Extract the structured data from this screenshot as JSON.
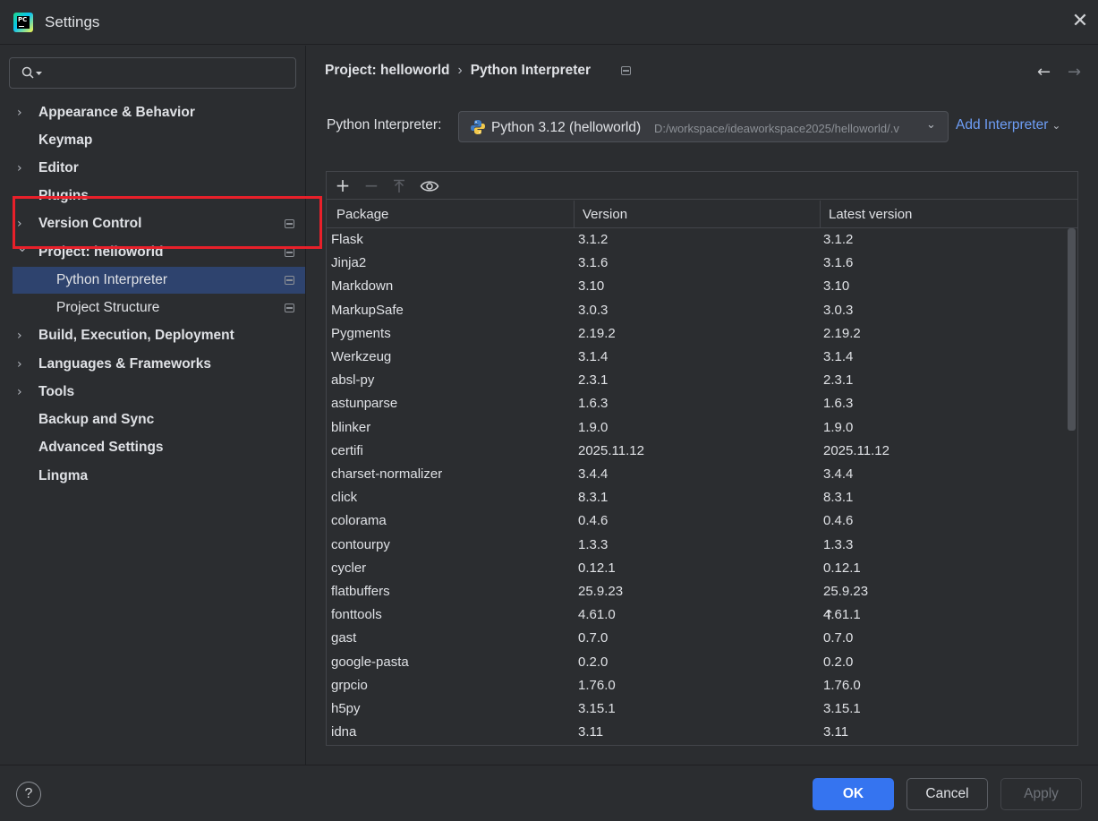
{
  "window": {
    "title": "Settings"
  },
  "search": {
    "placeholder": ""
  },
  "sidebar": {
    "items": [
      {
        "label": "Appearance & Behavior",
        "expandable": true,
        "expanded": false,
        "pinnable": false
      },
      {
        "label": "Keymap",
        "expandable": false,
        "pinnable": false
      },
      {
        "label": "Editor",
        "expandable": true,
        "expanded": false,
        "pinnable": false
      },
      {
        "label": "Plugins",
        "expandable": false,
        "pinnable": false
      },
      {
        "label": "Version Control",
        "expandable": true,
        "expanded": false,
        "pinnable": true
      },
      {
        "label": "Project: helloworld",
        "expandable": true,
        "expanded": true,
        "pinnable": true
      },
      {
        "label": "Python Interpreter",
        "sub": true,
        "selected": true,
        "pinnable": true
      },
      {
        "label": "Project Structure",
        "sub": true,
        "pinnable": true
      },
      {
        "label": "Build, Execution, Deployment",
        "expandable": true,
        "expanded": false,
        "pinnable": false
      },
      {
        "label": "Languages & Frameworks",
        "expandable": true,
        "expanded": false,
        "pinnable": false
      },
      {
        "label": "Tools",
        "expandable": true,
        "expanded": false,
        "pinnable": false
      },
      {
        "label": "Backup and Sync",
        "expandable": false,
        "pinnable": false
      },
      {
        "label": "Advanced Settings",
        "expandable": false,
        "pinnable": false
      },
      {
        "label": "Lingma",
        "expandable": false,
        "pinnable": false
      }
    ]
  },
  "breadcrumb": {
    "parent": "Project: helloworld",
    "current": "Python Interpreter"
  },
  "interpreter": {
    "label": "Python Interpreter:",
    "selected_name": "Python 3.12 (helloworld)",
    "selected_path": "D:/workspace/ideaworkspace2025/helloworld/.v",
    "add_label": "Add Interpreter"
  },
  "packages": {
    "toolbar": {
      "add": "+",
      "remove": "−",
      "upgrade": "⤒",
      "show": "eye"
    },
    "columns": [
      "Package",
      "Version",
      "Latest version"
    ],
    "rows": [
      {
        "name": "Flask",
        "version": "3.1.2",
        "latest": "3.1.2",
        "upgrade": false
      },
      {
        "name": "Jinja2",
        "version": "3.1.6",
        "latest": "3.1.6",
        "upgrade": false
      },
      {
        "name": "Markdown",
        "version": "3.10",
        "latest": "3.10",
        "upgrade": false
      },
      {
        "name": "MarkupSafe",
        "version": "3.0.3",
        "latest": "3.0.3",
        "upgrade": false
      },
      {
        "name": "Pygments",
        "version": "2.19.2",
        "latest": "2.19.2",
        "upgrade": false
      },
      {
        "name": "Werkzeug",
        "version": "3.1.4",
        "latest": "3.1.4",
        "upgrade": false
      },
      {
        "name": "absl-py",
        "version": "2.3.1",
        "latest": "2.3.1",
        "upgrade": false
      },
      {
        "name": "astunparse",
        "version": "1.6.3",
        "latest": "1.6.3",
        "upgrade": false
      },
      {
        "name": "blinker",
        "version": "1.9.0",
        "latest": "1.9.0",
        "upgrade": false
      },
      {
        "name": "certifi",
        "version": "2025.11.12",
        "latest": "2025.11.12",
        "upgrade": false
      },
      {
        "name": "charset-normalizer",
        "version": "3.4.4",
        "latest": "3.4.4",
        "upgrade": false
      },
      {
        "name": "click",
        "version": "8.3.1",
        "latest": "8.3.1",
        "upgrade": false
      },
      {
        "name": "colorama",
        "version": "0.4.6",
        "latest": "0.4.6",
        "upgrade": false
      },
      {
        "name": "contourpy",
        "version": "1.3.3",
        "latest": "1.3.3",
        "upgrade": false
      },
      {
        "name": "cycler",
        "version": "0.12.1",
        "latest": "0.12.1",
        "upgrade": false
      },
      {
        "name": "flatbuffers",
        "version": "25.9.23",
        "latest": "25.9.23",
        "upgrade": false
      },
      {
        "name": "fonttools",
        "version": "4.61.0",
        "latest": "4.61.1",
        "upgrade": true
      },
      {
        "name": "gast",
        "version": "0.7.0",
        "latest": "0.7.0",
        "upgrade": false
      },
      {
        "name": "google-pasta",
        "version": "0.2.0",
        "latest": "0.2.0",
        "upgrade": false
      },
      {
        "name": "grpcio",
        "version": "1.76.0",
        "latest": "1.76.0",
        "upgrade": false
      },
      {
        "name": "h5py",
        "version": "3.15.1",
        "latest": "3.15.1",
        "upgrade": false
      },
      {
        "name": "idna",
        "version": "3.11",
        "latest": "3.11",
        "upgrade": false
      }
    ]
  },
  "footer": {
    "help": "?",
    "ok": "OK",
    "cancel": "Cancel",
    "apply": "Apply"
  },
  "colors": {
    "accent": "#3574f0",
    "selection": "#2e436e",
    "highlight": "#e8202a",
    "link": "#6e9ef6"
  }
}
